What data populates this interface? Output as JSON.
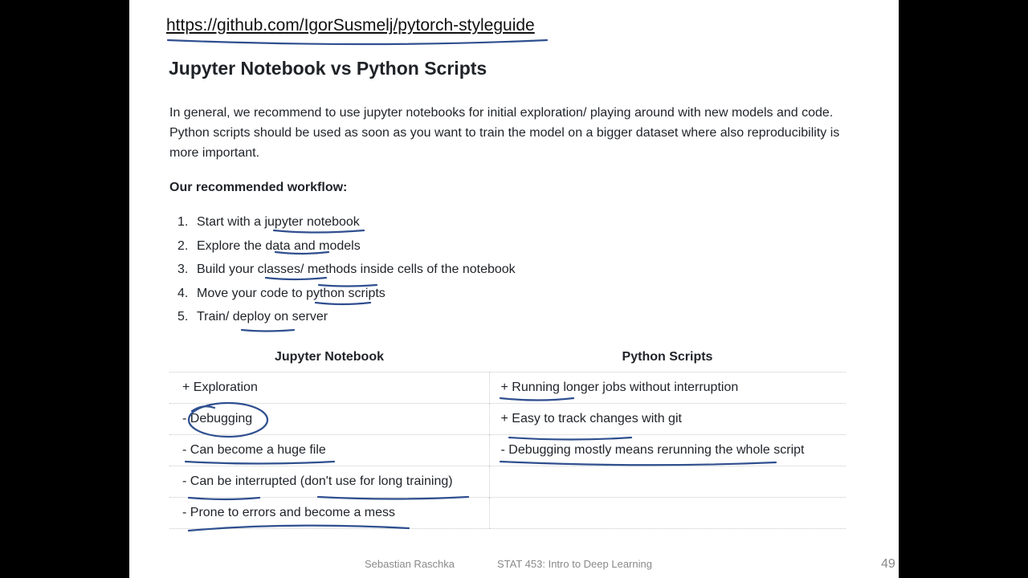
{
  "url": "https://github.com/IgorSusmelj/pytorch-styleguide",
  "title": "Jupyter Notebook vs Python Scripts",
  "intro": "In general, we recommend to use jupyter notebooks for initial exploration/ playing around with new models and code. Python scripts should be used as soon as you want to train the model on a bigger dataset where also reproducibility is more important.",
  "workflow": {
    "label": "Our recommended workflow:",
    "steps": [
      {
        "num": "1.",
        "text": "Start with a jupyter notebook"
      },
      {
        "num": "2.",
        "text": "Explore the data and models"
      },
      {
        "num": "3.",
        "text": "Build your classes/ methods inside cells of the notebook"
      },
      {
        "num": "4.",
        "text": "Move your code to python scripts"
      },
      {
        "num": "5.",
        "text": "Train/ deploy on server"
      }
    ]
  },
  "comparison": {
    "headers": [
      "Jupyter Notebook",
      "Python Scripts"
    ],
    "rows": [
      [
        "+ Exploration",
        "+ Running longer jobs without interruption"
      ],
      [
        "- Debugging",
        "+ Easy to track changes with git"
      ],
      [
        "- Can become a huge file",
        "- Debugging mostly means rerunning the whole script"
      ],
      [
        "- Can be interrupted (don't use for long training)",
        ""
      ],
      [
        "- Prone to errors and become a mess",
        ""
      ]
    ]
  },
  "footer": {
    "author": "Sebastian Raschka",
    "course": "STAT 453: Intro to Deep Learning",
    "page": "49"
  },
  "colors": {
    "background": "#000000",
    "slide": "#ffffff",
    "text": "#1f2328",
    "ink": "#2f4f8f",
    "footer": "#8a8a8a"
  }
}
